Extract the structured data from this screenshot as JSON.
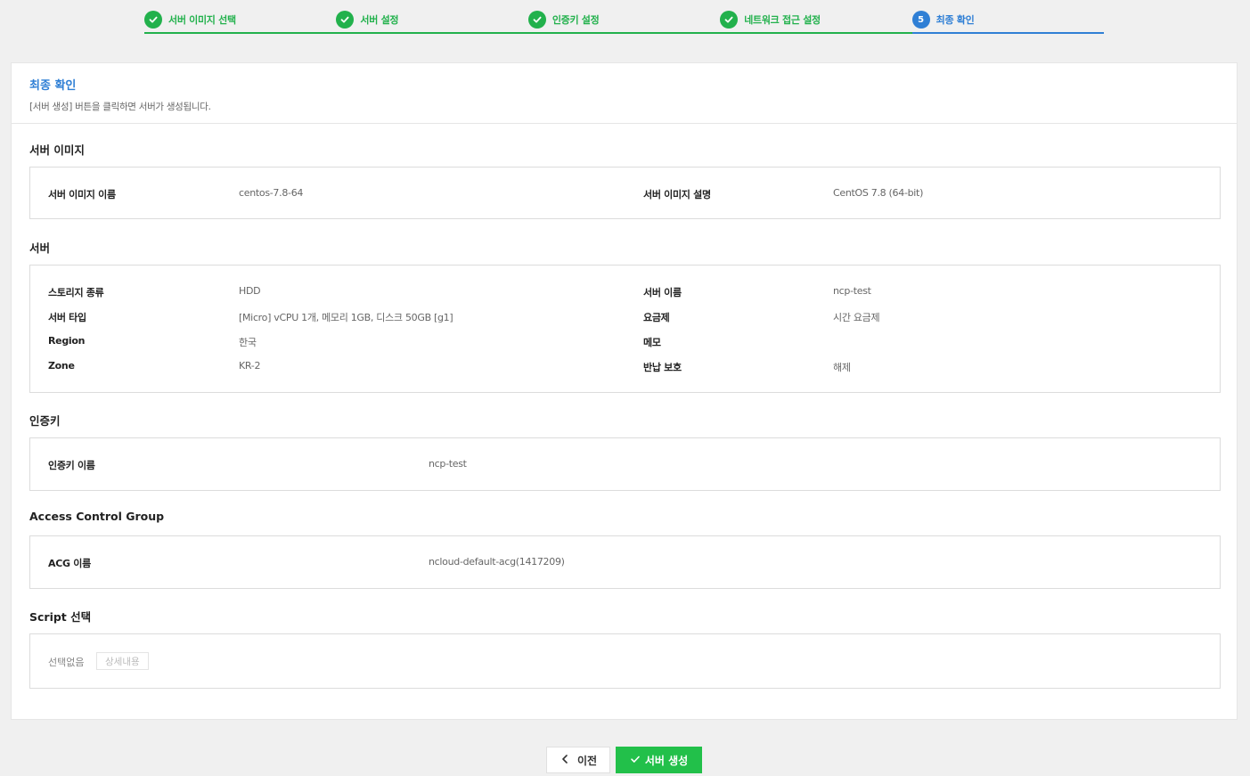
{
  "stepper": {
    "steps": [
      {
        "label": "서버 이미지 선택",
        "state": "done"
      },
      {
        "label": "서버 설정",
        "state": "done"
      },
      {
        "label": "인증키 설정",
        "state": "done"
      },
      {
        "label": "네트워크 접근 설정",
        "state": "done"
      },
      {
        "label": "최종 확인",
        "state": "current",
        "number": "5"
      }
    ]
  },
  "header": {
    "title": "최종 확인",
    "description": "[서버 생성] 버튼을 클릭하면 서버가 생성됩니다."
  },
  "server_image": {
    "title": "서버 이미지",
    "name_label": "서버 이미지 이름",
    "name_value": "centos-7.8-64",
    "desc_label": "서버 이미지 설명",
    "desc_value": "CentOS 7.8 (64-bit)"
  },
  "server": {
    "title": "서버",
    "left": [
      {
        "label": "스토리지 종류",
        "value": "HDD"
      },
      {
        "label": "서버 타입",
        "value": "[Micro] vCPU 1개, 메모리 1GB, 디스크 50GB [g1]"
      },
      {
        "label": "Region",
        "value": "한국"
      },
      {
        "label": "Zone",
        "value": "KR-2"
      }
    ],
    "right": [
      {
        "label": "서버 이름",
        "value": "ncp-test"
      },
      {
        "label": "요금제",
        "value": "시간 요금제"
      },
      {
        "label": "메모",
        "value": ""
      },
      {
        "label": "반납 보호",
        "value": "해제"
      }
    ]
  },
  "auth_key": {
    "title": "인증키",
    "label": "인증키 이름",
    "value": "ncp-test"
  },
  "acg": {
    "title": "Access Control Group",
    "label": "ACG 이름",
    "value": "ncloud-default-acg(1417209)"
  },
  "script": {
    "title": "Script 선택",
    "none_text": "선택없음",
    "detail_button": "상세내용"
  },
  "footer": {
    "prev_label": "이전",
    "create_label": "서버 생성"
  },
  "colors": {
    "done_green": "#22b14c",
    "current_blue": "#2f7fd5",
    "create_button": "#22c04a"
  }
}
